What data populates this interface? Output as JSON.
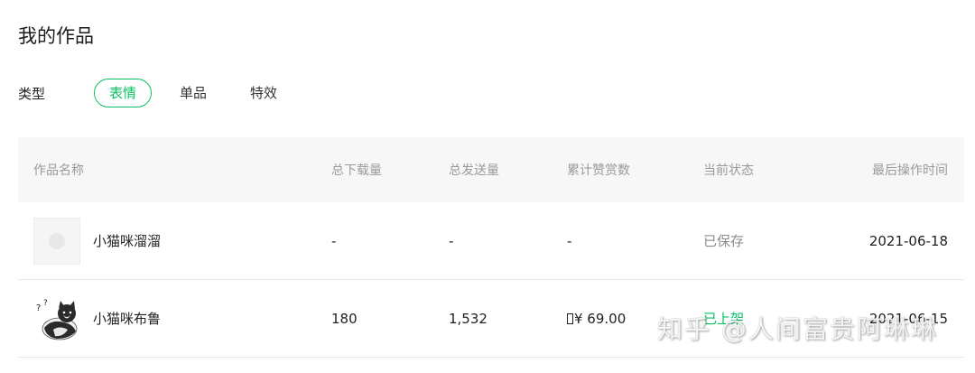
{
  "page": {
    "title": "我的作品"
  },
  "filter": {
    "label": "类型",
    "tabs": [
      {
        "label": "表情",
        "active": true
      },
      {
        "label": "单品",
        "active": false
      },
      {
        "label": "特效",
        "active": false
      }
    ]
  },
  "table": {
    "headers": [
      "作品名称",
      "总下载量",
      "总发送量",
      "累计赞赏数",
      "当前状态",
      "最后操作时间"
    ],
    "rows": [
      {
        "name": "小猫咪溜溜",
        "downloads": "-",
        "sends": "-",
        "rewards": "-",
        "status": "已保存",
        "time": "2021-06-18"
      },
      {
        "name": "小猫咪布鲁",
        "downloads": "180",
        "sends": "1,532",
        "rewards": "¥ 69.00",
        "status": "已上架",
        "time": "2021-06-15"
      }
    ]
  },
  "watermark": "知乎 @人间富贵阿琳琳",
  "colors": {
    "accent": "#07c160",
    "header_bg": "#f7f7f7",
    "muted": "#9a9a9a"
  }
}
